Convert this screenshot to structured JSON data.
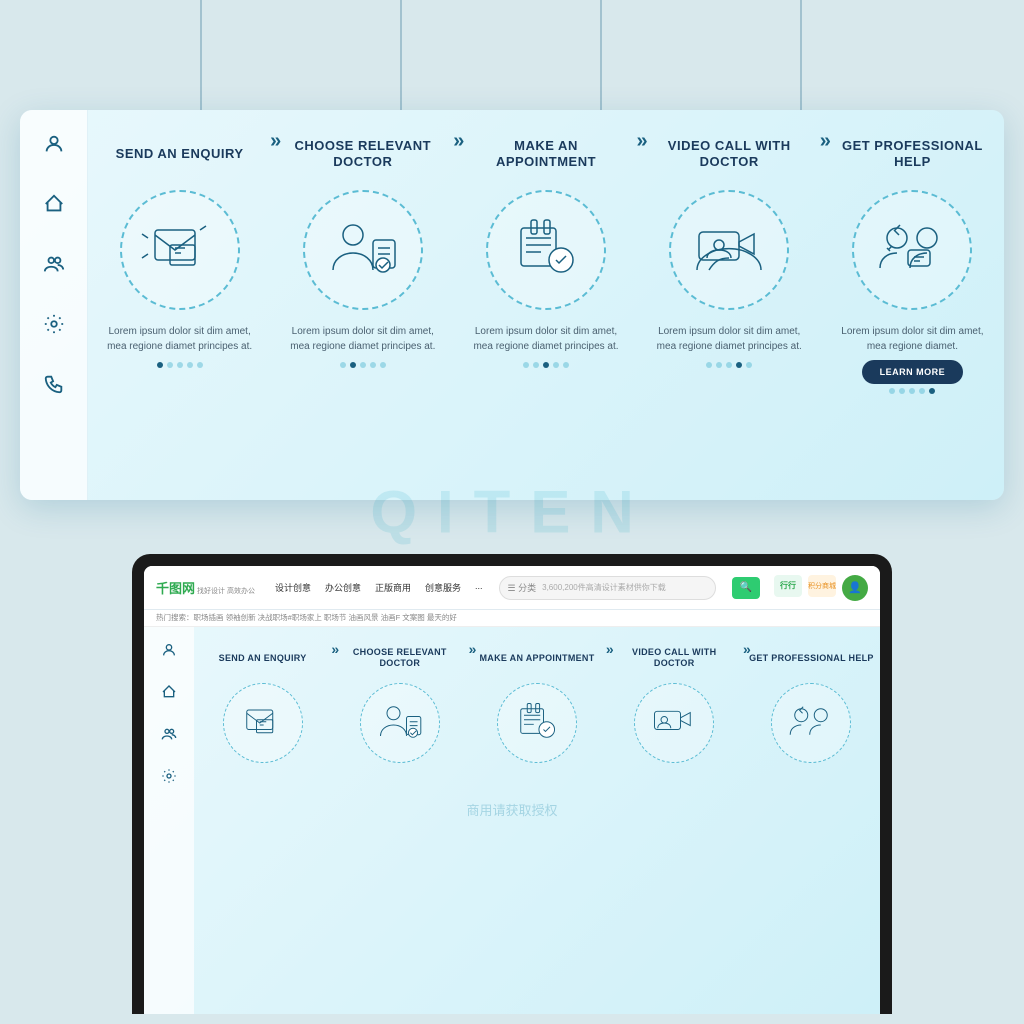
{
  "page": {
    "bg_color": "#d8e8ec"
  },
  "top_banner": {
    "sidebar_icons": [
      "👤",
      "🏠",
      "👥",
      "⚙️",
      "📞"
    ],
    "steps": [
      {
        "title": "SEND AN ENQUIRY",
        "text": "Lorem ipsum dolor sit dim amet, mea regione diamet principes at.",
        "dots": [
          true,
          false,
          false,
          false,
          false
        ]
      },
      {
        "title": "CHOOSE RELEVANT DOCTOR",
        "text": "Lorem ipsum dolor sit dim amet, mea regione diamet principes at.",
        "dots": [
          false,
          true,
          false,
          false,
          false
        ]
      },
      {
        "title": "MAKE AN APPOINTMENT",
        "text": "Lorem ipsum dolor sit dim amet, mea regione diamet principes at.",
        "dots": [
          false,
          false,
          true,
          false,
          false
        ]
      },
      {
        "title": "VIDEO CALL WITH DOCTOR",
        "text": "Lorem ipsum dolor sit dim amet, mea regione diamet principes at.",
        "dots": [
          false,
          false,
          false,
          true,
          false
        ]
      },
      {
        "title": "GET PROFESSIONAL HELP",
        "text": "Lorem ipsum dolor sit dim amet, mea regione diamet.",
        "dots": [
          false,
          false,
          false,
          false,
          true
        ],
        "has_button": true,
        "button_label": "LEARN MORE"
      }
    ]
  },
  "browser": {
    "logo": "千图网",
    "logo_sub": "找好设计 高效办公",
    "nav_items": [
      "设计创意",
      "办公创意",
      "正版商用",
      "创意服务",
      "..."
    ],
    "search_placeholder": "3,600,200件高清设计素材供你下载",
    "hot_tags": [
      "热门搜索：职场插画 领袖创新 决战职场#职场家上 职场节 油画风景 油画F 文案图  最天的好"
    ],
    "search_button": "🔍",
    "right_icons": [
      "行行",
      "积分商城"
    ]
  },
  "laptop_banner": {
    "sidebar_icons": [
      "👤",
      "🏠",
      "👥",
      "⚙️"
    ],
    "steps": [
      {
        "title": "SEND AN ENQUIRY"
      },
      {
        "title": "CHOOSE RELEVANT DOCTOR"
      },
      {
        "title": "MAKE AN APPOINTMENT"
      },
      {
        "title": "VIDEO CALL WITH DOCTOR"
      },
      {
        "title": "GET PROFESSIONAL HELP"
      }
    ]
  },
  "watermark": {
    "text": "QITEN",
    "cn_text": "商用请获取授权"
  }
}
